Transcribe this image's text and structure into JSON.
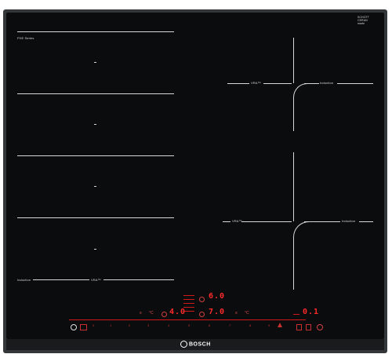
{
  "brand": {
    "logo_text": "BOSCH",
    "glass_brand_lines": [
      "SCHOTT",
      "CERAN",
      "made"
    ]
  },
  "zones": {
    "left_top_label": "PXE Series",
    "left_bottom_label_left": "Induction",
    "left_bottom_label_right": "VRA™",
    "right_top_label_left": "VRA™",
    "right_top_label_right": "Induction",
    "right_bottom_label_left": "VRA™",
    "right_bottom_label_right": "Induction"
  },
  "display": {
    "power_top": "6.0",
    "power_mid_left": "4.0",
    "power_mid_right": "7.0",
    "timer": "0.1",
    "left_small": [
      "≡",
      "°C"
    ],
    "mid_small": [
      "≡",
      "°C"
    ]
  },
  "controls": {
    "power_icon": "power-icon",
    "lock_icon": "child-lock-icon",
    "scale": [
      "0",
      "1",
      "2",
      "3",
      "4",
      "5",
      "6",
      "7",
      "8",
      "9"
    ],
    "boost_icon": "boost-icon",
    "timer_icons": [
      "timer-icon",
      "clock-icon",
      "settings-icon"
    ]
  }
}
